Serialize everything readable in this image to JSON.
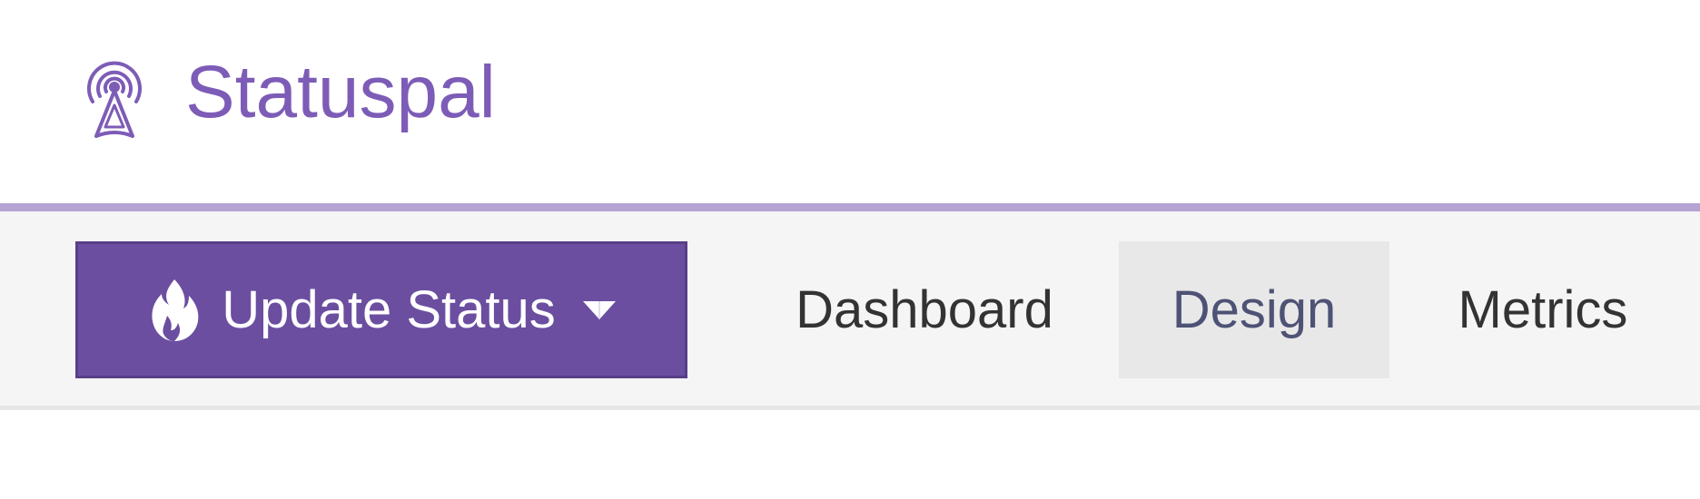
{
  "brand": {
    "name": "Statuspal",
    "logo_icon": "broadcast-tower-icon"
  },
  "colors": {
    "brand_purple": "#7d5cb7",
    "accent_line": "#b5a3d4",
    "button_bg": "#6b4ea0",
    "nav_bg": "#f5f5f5",
    "active_tab_bg": "#e8e8e8",
    "active_tab_text": "#4e5275"
  },
  "toolbar": {
    "update_status": {
      "label": "Update Status",
      "icon": "fire-icon",
      "caret_icon": "caret-down-icon"
    }
  },
  "nav": {
    "items": [
      {
        "label": "Dashboard",
        "active": false
      },
      {
        "label": "Design",
        "active": true
      },
      {
        "label": "Metrics",
        "active": false
      }
    ]
  }
}
